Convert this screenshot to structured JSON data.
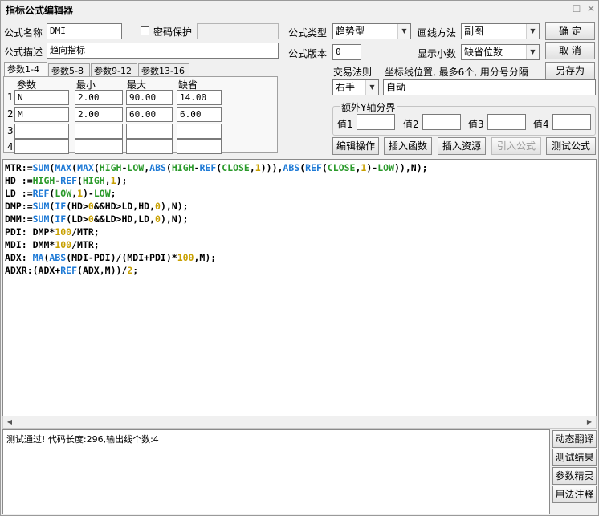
{
  "window": {
    "title": "指标公式编辑器"
  },
  "form": {
    "name_label": "公式名称",
    "name_value": "DMI",
    "password_label": "密码保护",
    "desc_label": "公式描述",
    "desc_value": "趋向指标",
    "type_label": "公式类型",
    "type_value": "趋势型",
    "draw_label": "画线方法",
    "draw_value": "副图",
    "version_label": "公式版本",
    "version_value": "0",
    "decimal_label": "显示小数",
    "decimal_value": "缺省位数",
    "trade_label": "交易法则",
    "trade_value": "右手",
    "coord_label": "坐标线位置, 最多6个, 用分号分隔",
    "coord_value": "自动",
    "yaxis_label": "额外Y轴分界",
    "yaxis_values": [
      "值1",
      "值2",
      "值3",
      "值4"
    ]
  },
  "buttons": {
    "ok": "确  定",
    "cancel": "取  消",
    "save_as": "另存为",
    "edit_op": "编辑操作",
    "insert_func": "插入函数",
    "insert_res": "插入资源",
    "import": "引入公式",
    "test": "测试公式",
    "dyn_translate": "动态翻译",
    "test_result": "测试结果",
    "param_tune": "参数精灵",
    "usage": "用法注释"
  },
  "params": {
    "tabs": [
      "参数1-4",
      "参数5-8",
      "参数9-12",
      "参数13-16"
    ],
    "headers": [
      "参数",
      "最小",
      "最大",
      "缺省"
    ],
    "rows": [
      {
        "idx": "1",
        "name": "N",
        "min": "2.00",
        "max": "90.00",
        "def": "14.00"
      },
      {
        "idx": "2",
        "name": "M",
        "min": "2.00",
        "max": "60.00",
        "def": "6.00"
      },
      {
        "idx": "3",
        "name": "",
        "min": "",
        "max": "",
        "def": ""
      },
      {
        "idx": "4",
        "name": "",
        "min": "",
        "max": "",
        "def": ""
      }
    ]
  },
  "code": [
    "MTR:=SUM(MAX(MAX(HIGH-LOW,ABS(HIGH-REF(CLOSE,1))),ABS(REF(CLOSE,1)-LOW)),N);",
    "HD :=HIGH-REF(HIGH,1);",
    "LD :=REF(LOW,1)-LOW;",
    "DMP:=SUM(IF(HD>0&&HD>LD,HD,0),N);",
    "DMM:=SUM(IF(LD>0&&LD>HD,LD,0),N);",
    "PDI: DMP*100/MTR;",
    "MDI: DMM*100/MTR;",
    "ADX: MA(ABS(MDI-PDI)/(MDI+PDI)*100,M);",
    "ADXR:(ADX+REF(ADX,M))/2;"
  ],
  "output": {
    "text": "测试通过! 代码长度:296,输出线个数:4"
  },
  "colors": {
    "function": "#1e7ad6",
    "keyword": "#2a9a2a",
    "number": "#c8a000"
  }
}
